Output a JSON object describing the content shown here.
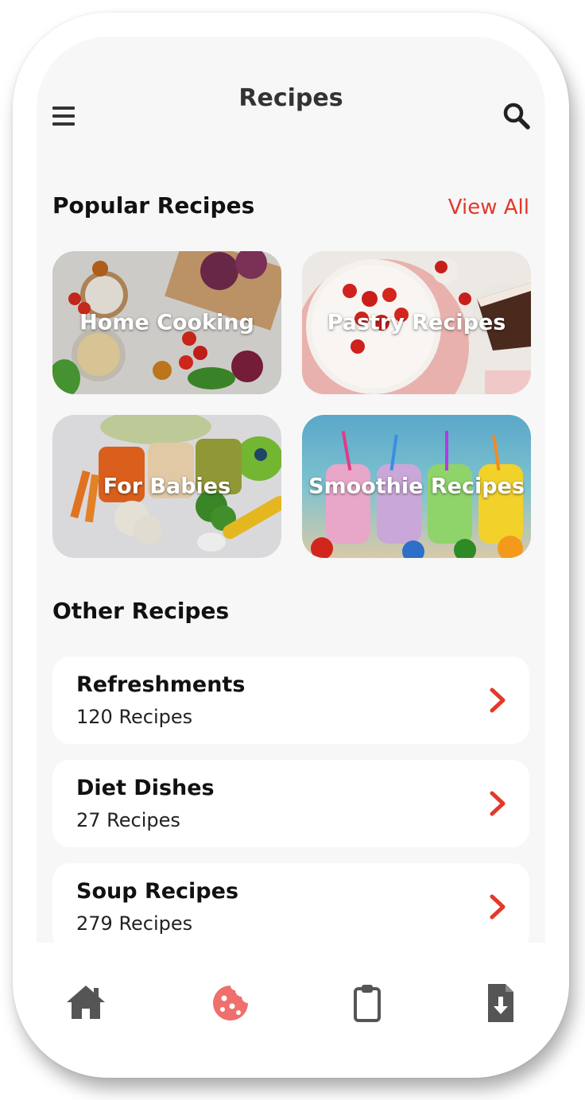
{
  "header": {
    "title": "Recipes",
    "menu_icon": "menu-icon",
    "search_icon": "search-icon"
  },
  "popular": {
    "title": "Popular Recipes",
    "view_all": "View All",
    "cards": [
      {
        "label": "Home Cooking"
      },
      {
        "label": "Pastry Recipes"
      },
      {
        "label": "For Babies"
      },
      {
        "label": "Smoothie Recipes"
      }
    ]
  },
  "other": {
    "title": "Other Recipes",
    "items": [
      {
        "title": "Refreshments",
        "count": "120 Recipes"
      },
      {
        "title": "Diet Dishes",
        "count": "27 Recipes"
      },
      {
        "title": "Soup Recipes",
        "count": "279 Recipes"
      }
    ]
  },
  "tabbar": {
    "tabs": [
      {
        "icon": "home-icon",
        "active": false
      },
      {
        "icon": "cookie-icon",
        "active": true
      },
      {
        "icon": "clipboard-icon",
        "active": false
      },
      {
        "icon": "download-file-icon",
        "active": false
      }
    ]
  },
  "colors": {
    "accent": "#e4382a",
    "active_tab": "#ef6f6c",
    "inactive_tab": "#555555",
    "screen_bg": "#f7f7f7"
  }
}
